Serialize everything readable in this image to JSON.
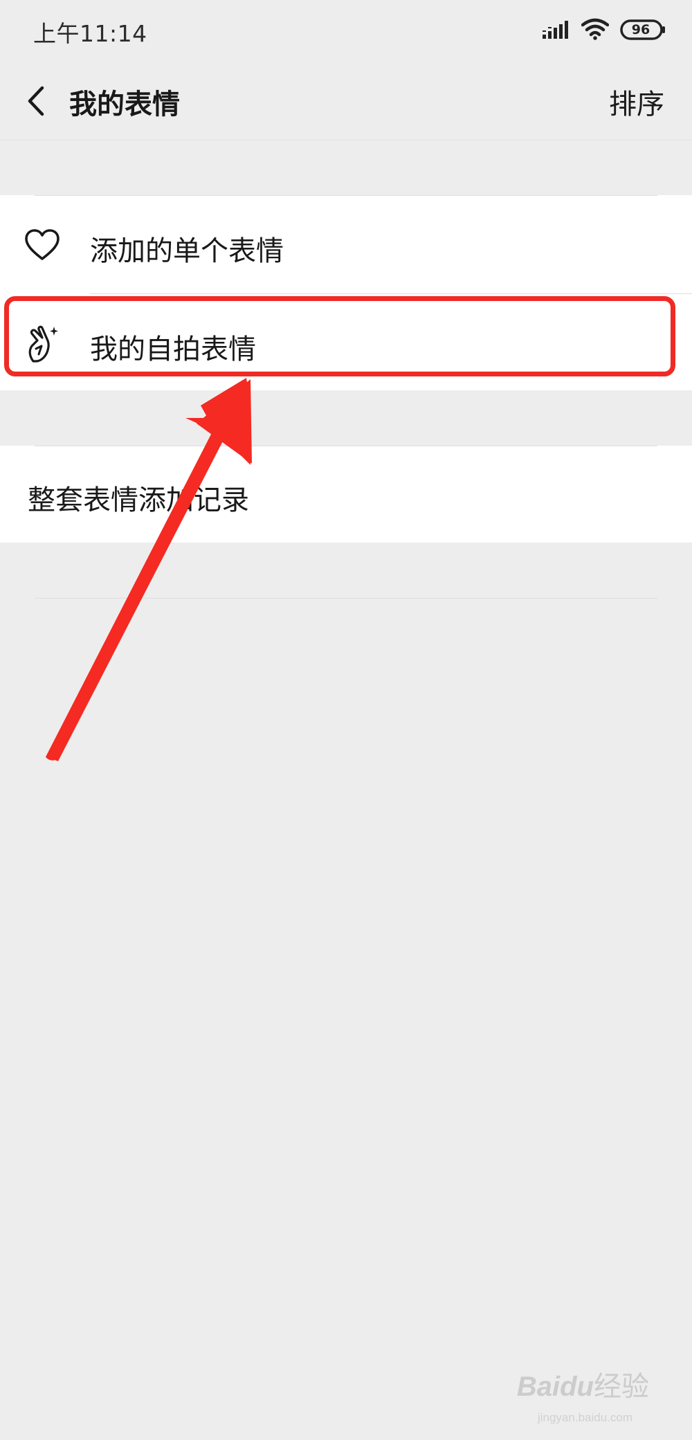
{
  "status_bar": {
    "time": "上午11:14",
    "battery": "96",
    "icons": [
      "signal-icon",
      "wifi-icon",
      "battery-icon"
    ]
  },
  "nav": {
    "title": "我的表情",
    "sort_label": "排序",
    "back_icon": "back-chevron-icon"
  },
  "list": {
    "items": [
      {
        "label": "添加的单个表情",
        "icon": "heart-icon"
      },
      {
        "label": "我的自拍表情",
        "icon": "selfie-hand-icon"
      }
    ],
    "history_label": "整套表情添加记录"
  },
  "annotation": {
    "highlight_color": "#f02a24",
    "arrow_color": "#f52a22"
  },
  "watermark": {
    "brand_text": "Bai",
    "brand_paw": "du",
    "brand_suffix": "经验",
    "url": "jingyan.baidu.com"
  }
}
